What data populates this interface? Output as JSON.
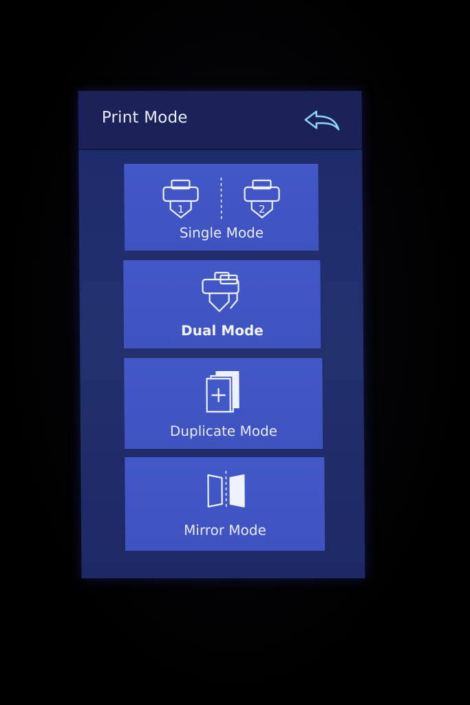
{
  "header": {
    "title": "Print Mode",
    "back_icon": "back-arrow-icon"
  },
  "modes": [
    {
      "label": "Single Mode",
      "icon": "single-extruders-icon",
      "extruder_numbers": [
        "1",
        "2"
      ]
    },
    {
      "label": "Dual Mode",
      "icon": "dual-extruder-icon"
    },
    {
      "label": "Duplicate Mode",
      "icon": "duplicate-icon"
    },
    {
      "label": "Mirror Mode",
      "icon": "mirror-icon"
    }
  ],
  "colors": {
    "screen_bg": "#1e2a6a",
    "header_bg": "#1a2258",
    "card_bg": "#4358c7",
    "text": "#e6ebff",
    "accent": "#8fd0ff"
  }
}
